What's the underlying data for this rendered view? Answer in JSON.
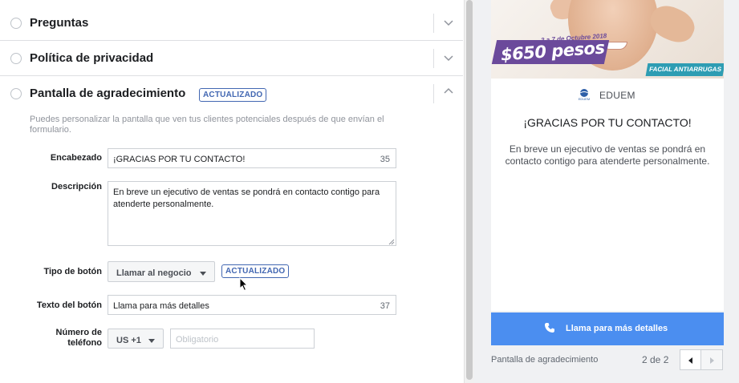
{
  "sections": {
    "preguntas": {
      "title": "Preguntas"
    },
    "privacidad": {
      "title": "Política de privacidad"
    },
    "agradecimiento": {
      "title": "Pantalla de agradecimiento",
      "badge": "ACTUALIZADO",
      "help": "Puedes personalizar la pantalla que ven tus clientes potenciales después de que envían el formulario."
    }
  },
  "form": {
    "encabezado": {
      "label": "Encabezado",
      "value": "¡GRACIAS POR TU CONTACTO!",
      "count": "35"
    },
    "descripcion": {
      "label": "Descripción",
      "value": "En breve un ejecutivo de ventas se pondrá en contacto contigo para atenderte personalmente."
    },
    "tipo_boton": {
      "label": "Tipo de botón",
      "value": "Llamar al negocio",
      "badge": "ACTUALIZADO"
    },
    "texto_boton": {
      "label": "Texto del botón",
      "value": "Llama para más detalles",
      "count": "37"
    },
    "telefono": {
      "label_line1": "Número de",
      "label_line2": "teléfono",
      "country": "US +1",
      "placeholder": "Obligatorio"
    }
  },
  "preview": {
    "ad": {
      "date": "3 a 7 de Octubre 2018",
      "price": "$650 pesos",
      "tag": "FACIAL ANTIARRUGAS"
    },
    "brand_logo_text": "EDUEM",
    "brand": "EDUEM",
    "title": "¡GRACIAS POR TU CONTACTO!",
    "description": "En breve un ejecutivo de ventas se pondrá en contacto contigo para atenderte personalmente.",
    "cta_label": "Llama para más detalles",
    "footer_label": "Pantalla de agradecimiento",
    "pager": "2 de 2"
  },
  "colors": {
    "accent": "#4267b2",
    "cta": "#4b8ef0",
    "promo": "#6b4a9b",
    "tag": "#2e9db3"
  },
  "icons": {
    "chevron": "chevron-down-icon",
    "chevron_up": "chevron-up-icon",
    "phone": "phone-icon",
    "prev": "prev-arrow-icon",
    "next": "next-arrow-icon"
  }
}
